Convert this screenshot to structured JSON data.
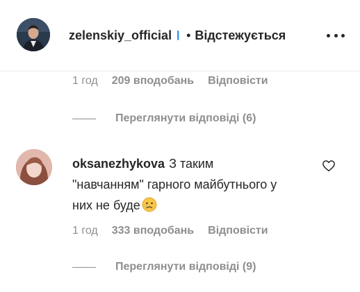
{
  "post_header": {
    "username": "zelenskiy_official",
    "separator": "•",
    "follow_state": "Відстежується"
  },
  "first_comment_meta": {
    "time": "1 год",
    "likes": "209 вподобань",
    "reply": "Відповісти"
  },
  "first_view_replies": "Переглянути відповіді (6)",
  "comment": {
    "username": "oksanezhykova",
    "text": "З таким \"навчанням\" гарного майбутнього у них не буде",
    "emoji": "crying-face-emoji",
    "meta": {
      "time": "1 год",
      "likes": "333 вподобань",
      "reply": "Відповісти"
    },
    "view_replies": "Переглянути відповіді (9)"
  },
  "colors": {
    "primary_text": "#262626",
    "secondary_text": "#8e8e8e",
    "verified_blue": "#3897f0",
    "divider": "#efefef"
  }
}
